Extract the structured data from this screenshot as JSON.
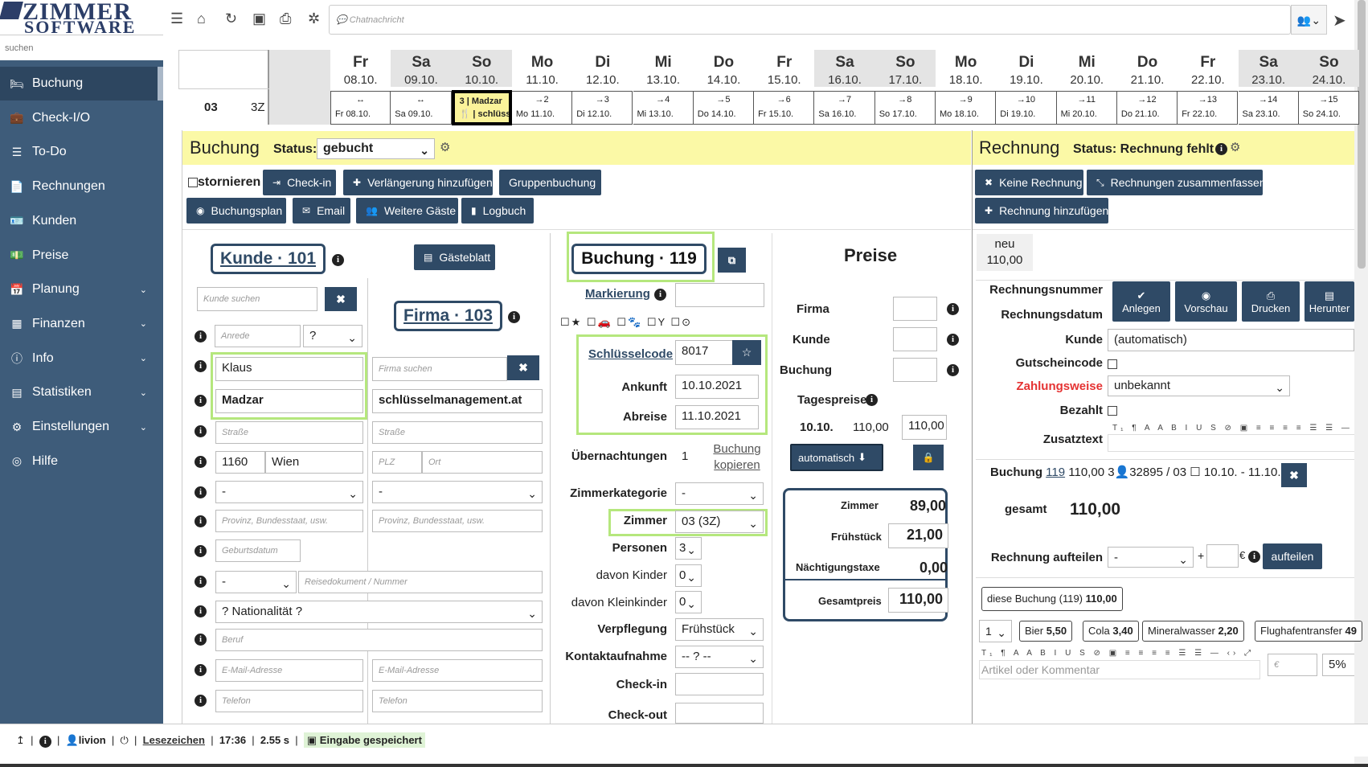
{
  "logo": {
    "line1": "ZIMMER",
    "line2": "SOFTWARE"
  },
  "sidebar": {
    "search_placeholder": "suchen",
    "items": [
      {
        "label": "Buchung",
        "icon": "bed-icon",
        "active": true
      },
      {
        "label": "Check-I/O",
        "icon": "suitcase-icon"
      },
      {
        "label": "To-Do",
        "icon": "list-icon"
      },
      {
        "label": "Rechnungen",
        "icon": "file-icon"
      },
      {
        "label": "Kunden",
        "icon": "address-card-icon"
      },
      {
        "label": "Preise",
        "icon": "money-icon"
      },
      {
        "label": "Planung",
        "icon": "calendar-icon",
        "chevron": true
      },
      {
        "label": "Finanzen",
        "icon": "table-icon",
        "chevron": true
      },
      {
        "label": "Info",
        "icon": "info-circle-icon",
        "chevron": true
      },
      {
        "label": "Statistiken",
        "icon": "bar-chart-icon",
        "chevron": true
      },
      {
        "label": "Einstellungen",
        "icon": "cog-icon",
        "chevron": true
      },
      {
        "label": "Hilfe",
        "icon": "life-ring-icon"
      }
    ]
  },
  "toolbar": {
    "chat_placeholder": "Chatnachricht"
  },
  "calendar": {
    "room_number": "03",
    "room_type": "3Z",
    "days": [
      {
        "wd": "Fr",
        "date": "08.10.",
        "we": false
      },
      {
        "wd": "Sa",
        "date": "09.10.",
        "we": true
      },
      {
        "wd": "So",
        "date": "10.10.",
        "we": true
      },
      {
        "wd": "Mo",
        "date": "11.10.",
        "we": false
      },
      {
        "wd": "Di",
        "date": "12.10.",
        "we": false
      },
      {
        "wd": "Mi",
        "date": "13.10.",
        "we": false
      },
      {
        "wd": "Do",
        "date": "14.10.",
        "we": false
      },
      {
        "wd": "Fr",
        "date": "15.10.",
        "we": false
      },
      {
        "wd": "Sa",
        "date": "16.10.",
        "we": true
      },
      {
        "wd": "So",
        "date": "17.10.",
        "we": true
      },
      {
        "wd": "Mo",
        "date": "18.10.",
        "we": false
      },
      {
        "wd": "Di",
        "date": "19.10.",
        "we": false
      },
      {
        "wd": "Mi",
        "date": "20.10.",
        "we": false
      },
      {
        "wd": "Do",
        "date": "21.10.",
        "we": false
      },
      {
        "wd": "Fr",
        "date": "22.10.",
        "we": false
      },
      {
        "wd": "Sa",
        "date": "23.10.",
        "we": true
      },
      {
        "wd": "So",
        "date": "24.10.",
        "we": true
      }
    ],
    "cells": [
      {
        "top": "↔",
        "bottom": "Fr 08.10."
      },
      {
        "top": "↔",
        "bottom": "Sa 09.10."
      },
      {
        "top": "3 | Madzar",
        "bottom": "🍴 | schlüsse",
        "booked": true
      },
      {
        "top": "→2",
        "bottom": "Mo 11.10."
      },
      {
        "top": "→3",
        "bottom": "Di 12.10."
      },
      {
        "top": "→4",
        "bottom": "Mi 13.10."
      },
      {
        "top": "→5",
        "bottom": "Do 14.10."
      },
      {
        "top": "→6",
        "bottom": "Fr 15.10."
      },
      {
        "top": "→7",
        "bottom": "Sa 16.10."
      },
      {
        "top": "→8",
        "bottom": "So 17.10."
      },
      {
        "top": "→9",
        "bottom": "Mo 18.10."
      },
      {
        "top": "→10",
        "bottom": "Di 19.10."
      },
      {
        "top": "→11",
        "bottom": "Mi 20.10."
      },
      {
        "top": "→12",
        "bottom": "Do 21.10."
      },
      {
        "top": "→13",
        "bottom": "Fr 22.10."
      },
      {
        "top": "→14",
        "bottom": "Sa 23.10."
      },
      {
        "top": "→15",
        "bottom": "So 24.10."
      }
    ]
  },
  "buchung": {
    "title": "Buchung",
    "status_label": "Status:",
    "status_value": "gebucht",
    "stornieren": "stornieren",
    "checkin": "Check-in",
    "verlaengerung": "Verlängerung hinzufügen",
    "gruppen": "Gruppenbuchung",
    "buchungsplan": "Buchungsplan",
    "email": "Email",
    "weitere": "Weitere Gäste",
    "logbuch": "Logbuch",
    "kunde_title": "Kunde · 101",
    "gaesteblatt": "Gästeblatt",
    "firma_title": "Firma · 103",
    "kunde_search": "Kunde suchen",
    "anrede_ph": "Anrede",
    "anrede_sel": "?",
    "firstname": "Klaus",
    "lastname": "Madzar",
    "firma_search": "Firma suchen",
    "firma_name": "schlüsselmanagement.at",
    "strasse_ph": "Straße",
    "plz": "1160",
    "ort": "Wien",
    "plz_ph": "PLZ",
    "ort_ph": "Ort",
    "dash": "-",
    "provinz_ph": "Provinz, Bundesstaat, usw.",
    "geburtsdatum_ph": "Geburtsdatum",
    "reisedok_ph": "Reisedokument / Nummer",
    "nationalitaet": "? Nationalität ?",
    "beruf_ph": "Beruf",
    "email_ph": "E-Mail-Adresse",
    "telefon_ph": "Telefon",
    "buchung_title": "Buchung · 119",
    "markierung": "Markierung",
    "schluesselcode_label": "Schlüsselcode",
    "schluesselcode": "8017",
    "ankunft_label": "Ankunft",
    "ankunft": "10.10.2021",
    "abreise_label": "Abreise",
    "abreise": "11.10.2021",
    "uebernachtungen_label": "Übernachtungen",
    "uebernachtungen": "1",
    "kopieren": "Buchung kopieren",
    "zimmerkat_label": "Zimmerkategorie",
    "zimmerkat": "-",
    "zimmer_label": "Zimmer",
    "zimmer": "03 (3Z)",
    "personen_label": "Personen",
    "personen": "3",
    "kinder_label": "davon Kinder",
    "kinder": "0",
    "kleinkinder_label": "davon Kleinkinder",
    "kleinkinder": "0",
    "verpflegung_label": "Verpflegung",
    "verpflegung": "Frühstück",
    "kontakt_label": "Kontaktaufnahme",
    "kontakt": "-- ? --",
    "checkin_label": "Check-in",
    "checkout_label": "Check-out"
  },
  "preise": {
    "title": "Preise",
    "firma": "Firma",
    "kunde": "Kunde",
    "buchung": "Buchung",
    "tagespreise": "Tagespreise",
    "tag": "10.10.",
    "tag_preis": "110,00",
    "tag_input": "110,00",
    "automatisch": "automatisch",
    "zimmer_label": "Zimmer",
    "zimmer": "89,00",
    "fruehstueck_label": "Frühstück",
    "fruehstueck": "21,00",
    "taxe_label": "Nächtigungstaxe",
    "taxe": "0,00",
    "gesamt_label": "Gesamtpreis",
    "gesamt": "110,00"
  },
  "rechnung": {
    "title": "Rechnung",
    "status": "Status: Rechnung fehlt",
    "keine": "Keine Rechnung",
    "zusammen": "Rechnungen zusammenfassen",
    "hinzu": "Rechnung hinzufügen",
    "tab_neu": "neu",
    "tab_betrag": "110,00",
    "nummer_label": "Rechnungsnummer",
    "datum_label": "Rechnungsdatum",
    "anlegen": "Anlegen",
    "vorschau": "Vorschau",
    "drucken": "Drucken",
    "herunter": "Herunter",
    "kunde_label": "Kunde",
    "kunde": "(automatisch)",
    "gutschein_label": "Gutscheincode",
    "zahlung_label": "Zahlungsweise",
    "zahlung": "unbekannt",
    "bezahlt_label": "Bezahlt",
    "zusatz_label": "Zusatztext",
    "line_text_a": "Buchung",
    "line_num": "119",
    "line_text_b": "110,00  3👤32895 / 03 ☐ 10.10. - 11.10.",
    "gesamt_label": "gesamt",
    "gesamt": "110,00",
    "aufteilen_label": "Rechnung aufteilen",
    "aufteilen_sel": "-",
    "aufteilen_btn": "aufteilen",
    "euro": "€",
    "plus": "+",
    "diese": "diese Buchung (119)",
    "diese_betrag": "110,00",
    "qty": "1",
    "products": [
      {
        "name": "Bier",
        "price": "5,50"
      },
      {
        "name": "Cola",
        "price": "3,40"
      },
      {
        "name": "Mineralwasser",
        "price": "2,20"
      },
      {
        "name": "Flughafentransfer",
        "price": "49"
      }
    ],
    "artikel_ph": "Artikel oder Kommentar",
    "euro_ph": "€",
    "pct": "5%"
  },
  "footer": {
    "user": "livion",
    "lesezeichen": "Lesezeichen",
    "time": "17:36",
    "duration": "2.55 s",
    "saved": "Eingabe gespeichert"
  }
}
